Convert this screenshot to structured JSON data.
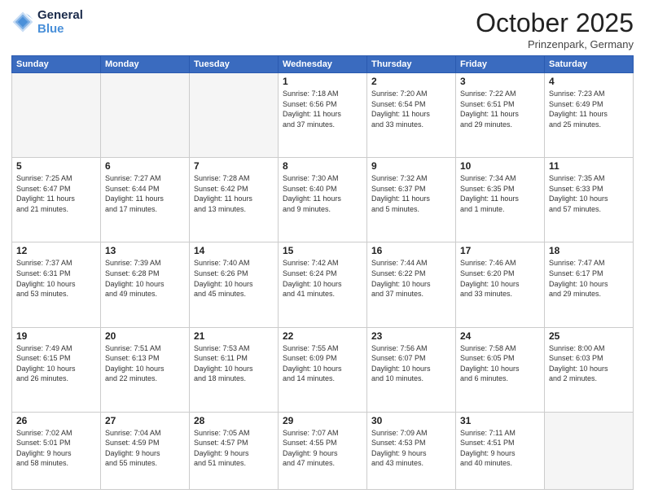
{
  "header": {
    "logo_line1": "General",
    "logo_line2": "Blue",
    "month": "October 2025",
    "location": "Prinzenpark, Germany"
  },
  "days_of_week": [
    "Sunday",
    "Monday",
    "Tuesday",
    "Wednesday",
    "Thursday",
    "Friday",
    "Saturday"
  ],
  "weeks": [
    [
      {
        "day": "",
        "info": ""
      },
      {
        "day": "",
        "info": ""
      },
      {
        "day": "",
        "info": ""
      },
      {
        "day": "1",
        "info": "Sunrise: 7:18 AM\nSunset: 6:56 PM\nDaylight: 11 hours\nand 37 minutes."
      },
      {
        "day": "2",
        "info": "Sunrise: 7:20 AM\nSunset: 6:54 PM\nDaylight: 11 hours\nand 33 minutes."
      },
      {
        "day": "3",
        "info": "Sunrise: 7:22 AM\nSunset: 6:51 PM\nDaylight: 11 hours\nand 29 minutes."
      },
      {
        "day": "4",
        "info": "Sunrise: 7:23 AM\nSunset: 6:49 PM\nDaylight: 11 hours\nand 25 minutes."
      }
    ],
    [
      {
        "day": "5",
        "info": "Sunrise: 7:25 AM\nSunset: 6:47 PM\nDaylight: 11 hours\nand 21 minutes."
      },
      {
        "day": "6",
        "info": "Sunrise: 7:27 AM\nSunset: 6:44 PM\nDaylight: 11 hours\nand 17 minutes."
      },
      {
        "day": "7",
        "info": "Sunrise: 7:28 AM\nSunset: 6:42 PM\nDaylight: 11 hours\nand 13 minutes."
      },
      {
        "day": "8",
        "info": "Sunrise: 7:30 AM\nSunset: 6:40 PM\nDaylight: 11 hours\nand 9 minutes."
      },
      {
        "day": "9",
        "info": "Sunrise: 7:32 AM\nSunset: 6:37 PM\nDaylight: 11 hours\nand 5 minutes."
      },
      {
        "day": "10",
        "info": "Sunrise: 7:34 AM\nSunset: 6:35 PM\nDaylight: 11 hours\nand 1 minute."
      },
      {
        "day": "11",
        "info": "Sunrise: 7:35 AM\nSunset: 6:33 PM\nDaylight: 10 hours\nand 57 minutes."
      }
    ],
    [
      {
        "day": "12",
        "info": "Sunrise: 7:37 AM\nSunset: 6:31 PM\nDaylight: 10 hours\nand 53 minutes."
      },
      {
        "day": "13",
        "info": "Sunrise: 7:39 AM\nSunset: 6:28 PM\nDaylight: 10 hours\nand 49 minutes."
      },
      {
        "day": "14",
        "info": "Sunrise: 7:40 AM\nSunset: 6:26 PM\nDaylight: 10 hours\nand 45 minutes."
      },
      {
        "day": "15",
        "info": "Sunrise: 7:42 AM\nSunset: 6:24 PM\nDaylight: 10 hours\nand 41 minutes."
      },
      {
        "day": "16",
        "info": "Sunrise: 7:44 AM\nSunset: 6:22 PM\nDaylight: 10 hours\nand 37 minutes."
      },
      {
        "day": "17",
        "info": "Sunrise: 7:46 AM\nSunset: 6:20 PM\nDaylight: 10 hours\nand 33 minutes."
      },
      {
        "day": "18",
        "info": "Sunrise: 7:47 AM\nSunset: 6:17 PM\nDaylight: 10 hours\nand 29 minutes."
      }
    ],
    [
      {
        "day": "19",
        "info": "Sunrise: 7:49 AM\nSunset: 6:15 PM\nDaylight: 10 hours\nand 26 minutes."
      },
      {
        "day": "20",
        "info": "Sunrise: 7:51 AM\nSunset: 6:13 PM\nDaylight: 10 hours\nand 22 minutes."
      },
      {
        "day": "21",
        "info": "Sunrise: 7:53 AM\nSunset: 6:11 PM\nDaylight: 10 hours\nand 18 minutes."
      },
      {
        "day": "22",
        "info": "Sunrise: 7:55 AM\nSunset: 6:09 PM\nDaylight: 10 hours\nand 14 minutes."
      },
      {
        "day": "23",
        "info": "Sunrise: 7:56 AM\nSunset: 6:07 PM\nDaylight: 10 hours\nand 10 minutes."
      },
      {
        "day": "24",
        "info": "Sunrise: 7:58 AM\nSunset: 6:05 PM\nDaylight: 10 hours\nand 6 minutes."
      },
      {
        "day": "25",
        "info": "Sunrise: 8:00 AM\nSunset: 6:03 PM\nDaylight: 10 hours\nand 2 minutes."
      }
    ],
    [
      {
        "day": "26",
        "info": "Sunrise: 7:02 AM\nSunset: 5:01 PM\nDaylight: 9 hours\nand 58 minutes."
      },
      {
        "day": "27",
        "info": "Sunrise: 7:04 AM\nSunset: 4:59 PM\nDaylight: 9 hours\nand 55 minutes."
      },
      {
        "day": "28",
        "info": "Sunrise: 7:05 AM\nSunset: 4:57 PM\nDaylight: 9 hours\nand 51 minutes."
      },
      {
        "day": "29",
        "info": "Sunrise: 7:07 AM\nSunset: 4:55 PM\nDaylight: 9 hours\nand 47 minutes."
      },
      {
        "day": "30",
        "info": "Sunrise: 7:09 AM\nSunset: 4:53 PM\nDaylight: 9 hours\nand 43 minutes."
      },
      {
        "day": "31",
        "info": "Sunrise: 7:11 AM\nSunset: 4:51 PM\nDaylight: 9 hours\nand 40 minutes."
      },
      {
        "day": "",
        "info": ""
      }
    ]
  ]
}
